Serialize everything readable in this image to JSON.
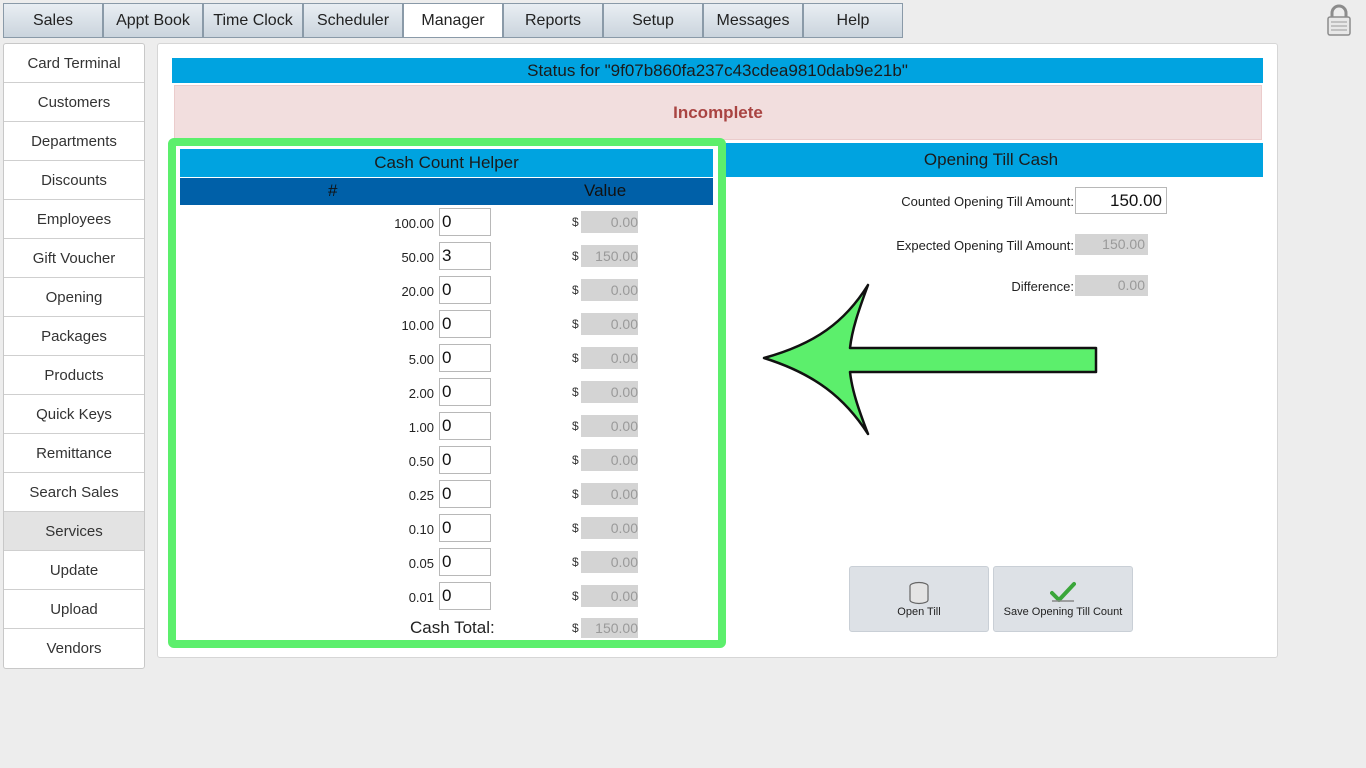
{
  "tabs": [
    "Sales",
    "Appt Book",
    "Time Clock",
    "Scheduler",
    "Manager",
    "Reports",
    "Setup",
    "Messages",
    "Help"
  ],
  "active_tab": "Manager",
  "sidebar": {
    "items": [
      "Card Terminal",
      "Customers",
      "Departments",
      "Discounts",
      "Employees",
      "Gift Voucher",
      "Opening",
      "Packages",
      "Products",
      "Quick Keys",
      "Remittance",
      "Search Sales",
      "Services",
      "Update",
      "Upload",
      "Vendors"
    ],
    "selected": "Services"
  },
  "status": {
    "title": "Status for \"9f07b860fa237c43cdea9810dab9e21b\"",
    "message": "Incomplete"
  },
  "helper": {
    "title": "Cash Count Helper",
    "col_count": "#",
    "col_value": "Value",
    "currency_symbol": "$",
    "rows": [
      {
        "denom": "100.00",
        "count": "0",
        "value": "0.00"
      },
      {
        "denom": "50.00",
        "count": "3",
        "value": "150.00"
      },
      {
        "denom": "20.00",
        "count": "0",
        "value": "0.00"
      },
      {
        "denom": "10.00",
        "count": "0",
        "value": "0.00"
      },
      {
        "denom": "5.00",
        "count": "0",
        "value": "0.00"
      },
      {
        "denom": "2.00",
        "count": "0",
        "value": "0.00"
      },
      {
        "denom": "1.00",
        "count": "0",
        "value": "0.00"
      },
      {
        "denom": "0.50",
        "count": "0",
        "value": "0.00"
      },
      {
        "denom": "0.25",
        "count": "0",
        "value": "0.00"
      },
      {
        "denom": "0.10",
        "count": "0",
        "value": "0.00"
      },
      {
        "denom": "0.05",
        "count": "0",
        "value": "0.00"
      },
      {
        "denom": "0.01",
        "count": "0",
        "value": "0.00"
      }
    ],
    "total_label": "Cash Total:",
    "total_value": "150.00"
  },
  "till": {
    "title": "Opening Till Cash",
    "counted_label": "Counted Opening Till Amount:",
    "counted_value": "150.00",
    "expected_label": "Expected Opening Till Amount:",
    "expected_value": "150.00",
    "difference_label": "Difference:",
    "difference_value": "0.00"
  },
  "buttons": {
    "open_till": "Open Till",
    "save_count": "Save Opening Till Count"
  },
  "colors": {
    "header_blue": "#00a3e0",
    "column_blue": "#0060a8",
    "highlight_green": "#5cef6c",
    "alert_text": "#a94442"
  },
  "icons": {
    "lock": "lock-icon",
    "open_till": "coins-stack-icon",
    "save_count": "checkmark-icon",
    "annotation": "arrow-left-icon"
  }
}
